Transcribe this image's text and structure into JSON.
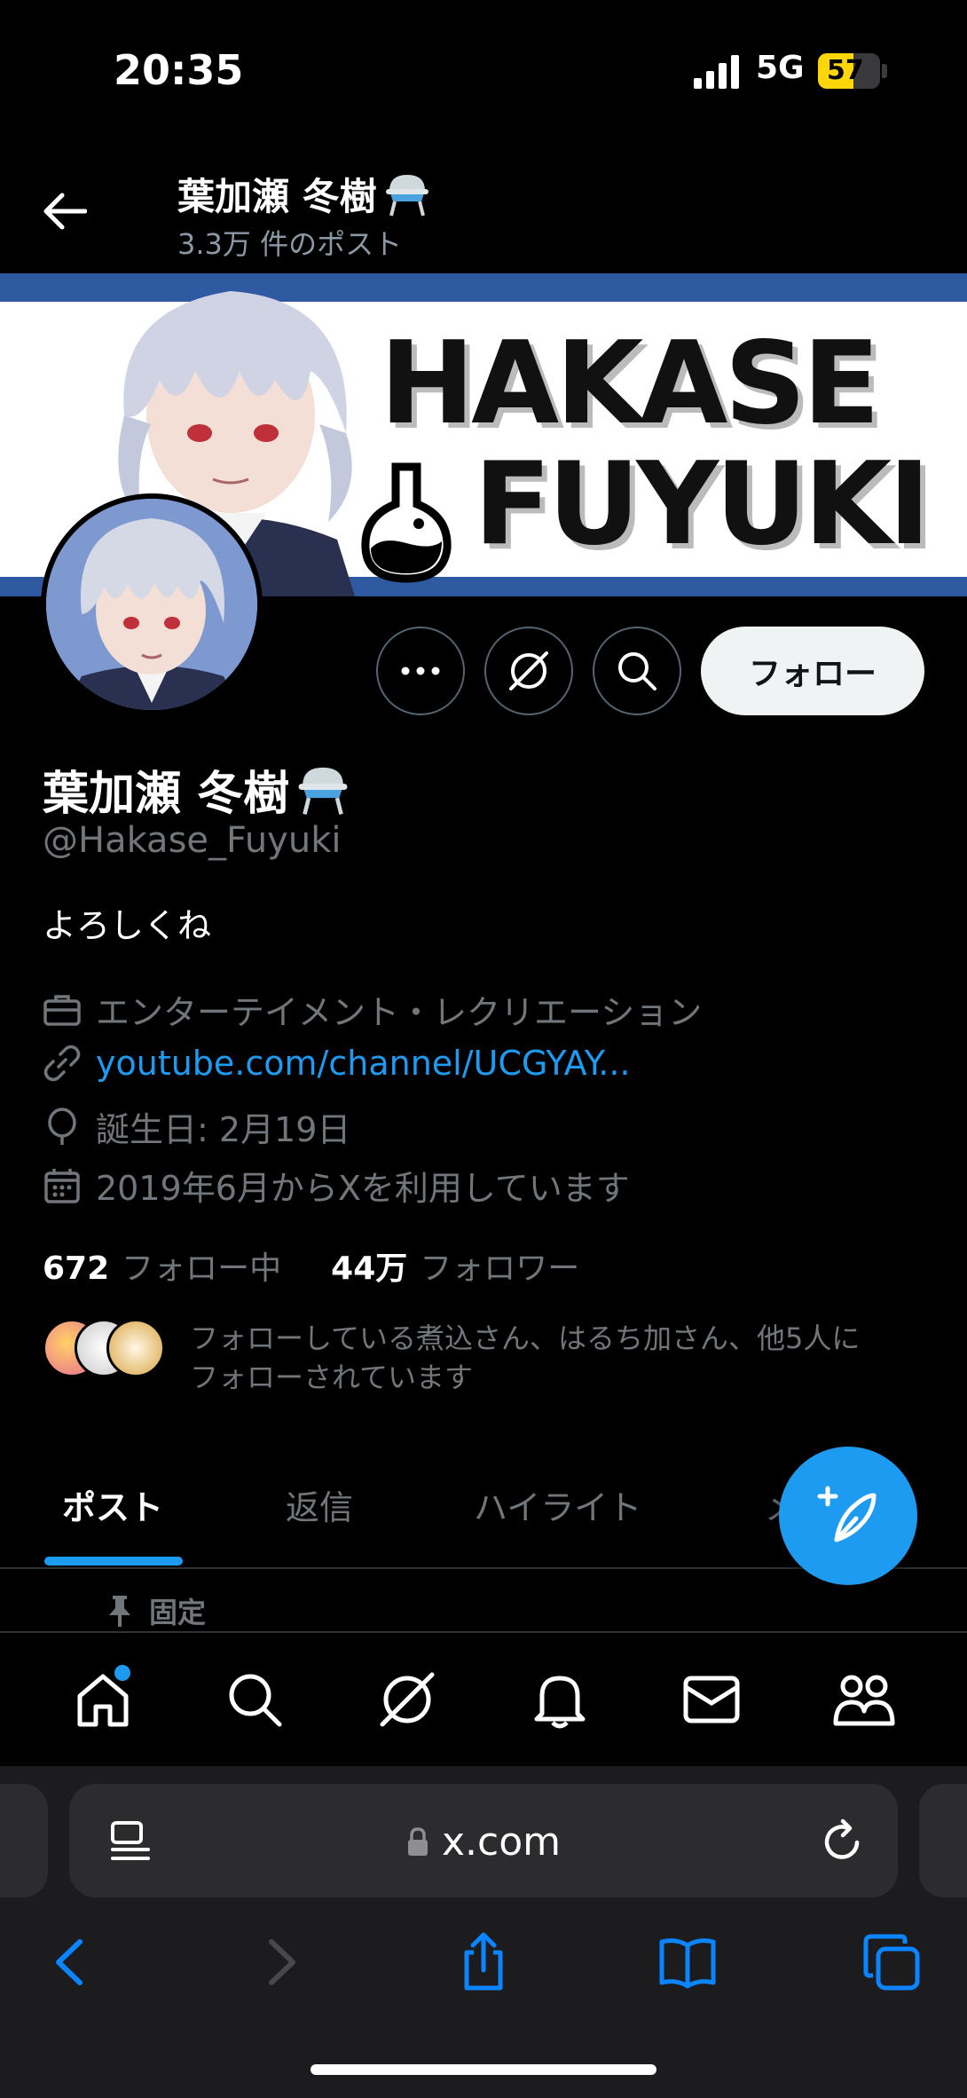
{
  "status_bar": {
    "time": "20:35",
    "network": "5G",
    "battery": "57"
  },
  "header": {
    "title": "葉加瀬 冬樹",
    "post_count": "3.3万 件のポスト"
  },
  "banner": {
    "line1": "HAKASE",
    "line2": "FUYUKI"
  },
  "actions": {
    "follow_label": "フォロー"
  },
  "profile": {
    "name": "葉加瀬 冬樹",
    "handle": "@Hakase_Fuyuki",
    "bio": "よろしくね",
    "category": "エンターテイメント・レクリエーション",
    "link": "youtube.com/channel/UCGYAY...",
    "birthday": "誕生日: 2月19日",
    "joined": "2019年6月からXを利用しています"
  },
  "stats": {
    "following_count": "672",
    "following_label": "フォロー中",
    "followers_count": "44万",
    "followers_label": "フォロワー"
  },
  "followed_by": {
    "line1": "フォローしている煮込さん、はるち加さん、他5人に",
    "line2": "フォローされています"
  },
  "tabs": [
    {
      "label": "ポスト"
    },
    {
      "label": "返信"
    },
    {
      "label": "ハイライト"
    },
    {
      "label": "メ"
    }
  ],
  "pinned_label": "固定",
  "browser": {
    "url": "x.com"
  },
  "colors": {
    "accent": "#1d9bf0",
    "background": "#000000",
    "secondary_text": "#71767b",
    "battery": "#ffd60a"
  },
  "icons": {
    "nav": [
      "home-icon",
      "search-icon",
      "grok-icon",
      "notifications-icon",
      "messages-icon",
      "communities-icon"
    ],
    "browser": [
      "back-icon",
      "forward-icon",
      "share-icon",
      "bookmarks-icon",
      "tabs-icon"
    ]
  }
}
